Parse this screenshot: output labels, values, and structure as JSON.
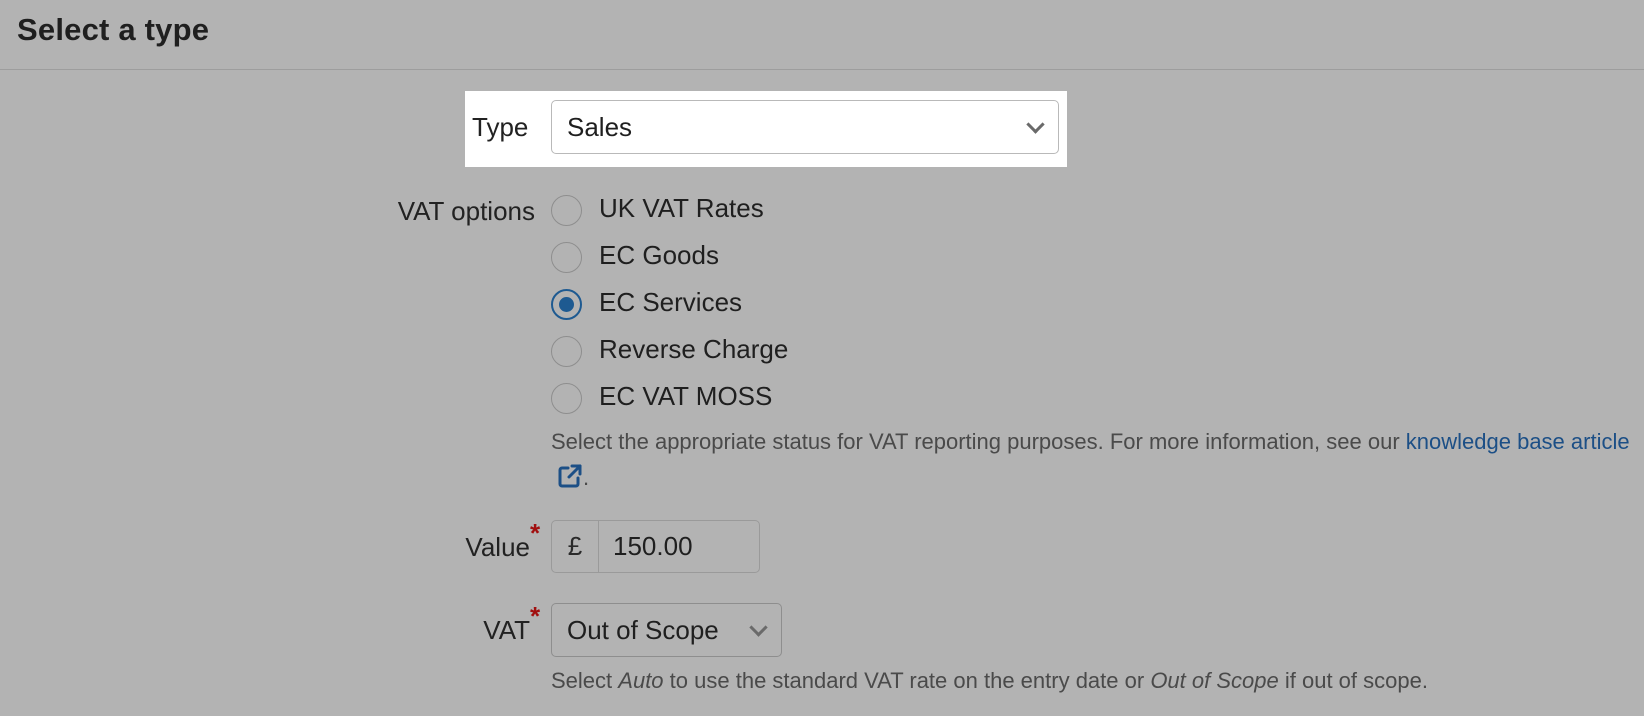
{
  "header": {
    "title": "Select a type"
  },
  "type_field": {
    "label": "Type",
    "value": "Sales"
  },
  "vat_options": {
    "label": "VAT options",
    "options": [
      {
        "label": "UK VAT Rates",
        "checked": false
      },
      {
        "label": "EC Goods",
        "checked": false
      },
      {
        "label": "EC Services",
        "checked": true
      },
      {
        "label": "Reverse Charge",
        "checked": false
      },
      {
        "label": "EC VAT MOSS",
        "checked": false
      }
    ],
    "help_text": "Select the appropriate status for VAT reporting purposes. For more information, see our",
    "help_link": "knowledge base article",
    "help_end": "."
  },
  "value_field": {
    "label": "Value",
    "required_mark": "*",
    "currency_symbol": "£",
    "value": "150.00"
  },
  "vat_field": {
    "label": "VAT",
    "required_mark": "*",
    "value": "Out of Scope",
    "help_pre": "Select",
    "help_auto": "Auto",
    "help_mid": "to use the standard VAT rate on the entry date or",
    "help_oos": "Out of Scope",
    "help_post": "if out of scope."
  },
  "colors": {
    "accent": "#1e5a91",
    "link": "#1c4f86",
    "required": "#a10f0f",
    "background": "#b3b3b3"
  },
  "icons": {
    "dropdown": "chevron-down-icon",
    "external_link": "external-link-icon"
  }
}
